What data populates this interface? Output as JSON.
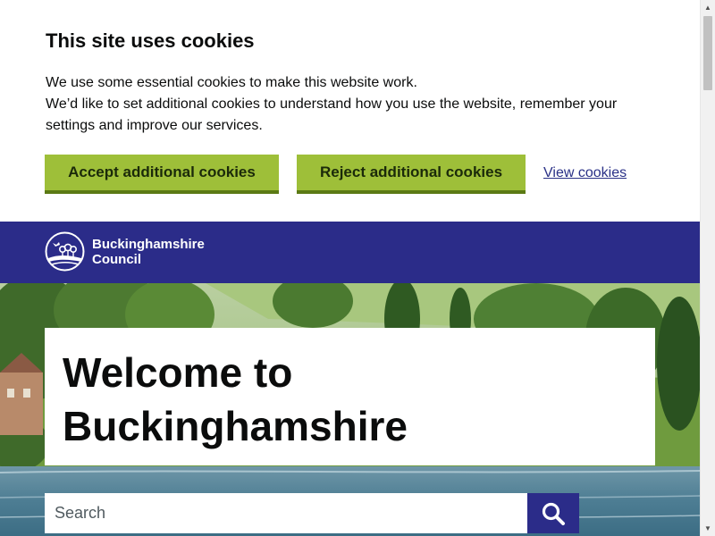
{
  "cookie_banner": {
    "title": "This site uses cookies",
    "line1": "We use some essential cookies to make this website work.",
    "line2": "We’d like to set additional cookies to understand how you use the website, remember your settings and improve our services.",
    "accept_label": "Accept additional cookies",
    "reject_label": "Reject additional cookies",
    "view_label": "View cookies"
  },
  "header": {
    "logo_line1": "Buckinghamshire",
    "logo_line2": "Council"
  },
  "hero": {
    "title": "Welcome to Buckinghamshire"
  },
  "search": {
    "placeholder": "Search"
  },
  "icons": {
    "search": "search-icon",
    "logo": "council-logo-icon",
    "scroll_up": "chevron-up-icon",
    "scroll_down": "chevron-down-icon"
  },
  "colors": {
    "brand_blue": "#2b2c89",
    "button_green": "#9ebf39",
    "button_shadow": "#5b7a14",
    "link": "#2a3187",
    "text": "#0b0c0c"
  }
}
